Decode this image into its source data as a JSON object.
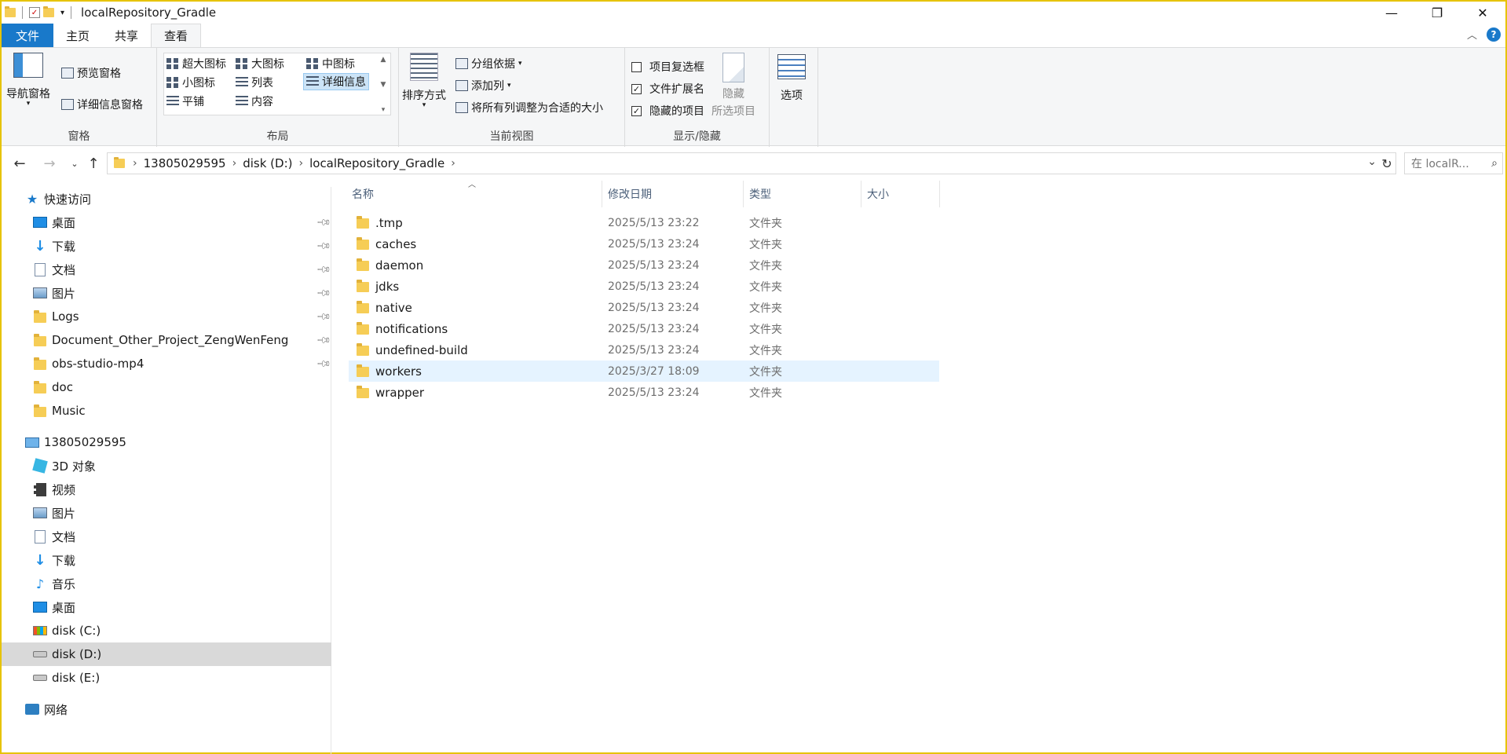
{
  "window": {
    "title": "localRepository_Gradle",
    "controls": {
      "minimize": "—",
      "maximize": "❐",
      "close": "✕"
    }
  },
  "tabs": [
    {
      "label": "文件"
    },
    {
      "label": "主页"
    },
    {
      "label": "共享"
    },
    {
      "label": "查看"
    }
  ],
  "ribbon": {
    "panes": {
      "nav_pane": "导航窗格",
      "preview_pane": "预览窗格",
      "details_pane": "详细信息窗格",
      "group_label": "窗格"
    },
    "layout": {
      "extra_large": "超大图标",
      "large": "大图标",
      "medium": "中图标",
      "small": "小图标",
      "list": "列表",
      "details": "详细信息",
      "tiles": "平铺",
      "content": "内容",
      "group_label": "布局"
    },
    "current_view": {
      "sort_by": "排序方式",
      "group_by": "分组依据",
      "add_columns": "添加列",
      "fit_columns": "将所有列调整为合适的大小",
      "group_label": "当前视图"
    },
    "show_hide": {
      "item_checkboxes": "项目复选框",
      "item_checkboxes_checked": false,
      "file_extensions": "文件扩展名",
      "file_extensions_checked": true,
      "hidden_items": "隐藏的项目",
      "hidden_items_checked": true,
      "hide_selected_line1": "隐藏",
      "hide_selected_line2": "所选项目",
      "group_label": "显示/隐藏"
    },
    "options": "选项"
  },
  "address": {
    "crumbs": [
      "13805029595",
      "disk (D:)",
      "localRepository_Gradle"
    ],
    "search_placeholder": "在 localR..."
  },
  "sidebar": {
    "quick_access": "快速访问",
    "pinned": [
      {
        "label": "桌面",
        "icon": "desktop-icon"
      },
      {
        "label": "下载",
        "icon": "download-icon"
      },
      {
        "label": "文档",
        "icon": "document-icon"
      },
      {
        "label": "图片",
        "icon": "pictures-icon"
      },
      {
        "label": "Logs",
        "icon": "folder-icon"
      },
      {
        "label": "Document_Other_Project_ZengWenFeng",
        "icon": "folder-icon"
      },
      {
        "label": "obs-studio-mp4",
        "icon": "folder-icon"
      },
      {
        "label": "doc",
        "icon": "folder-icon"
      },
      {
        "label": "Music",
        "icon": "folder-icon"
      }
    ],
    "this_pc": "13805029595",
    "pc_items": [
      {
        "label": "3D 对象",
        "icon": "3d-objects-icon"
      },
      {
        "label": "视频",
        "icon": "videos-icon"
      },
      {
        "label": "图片",
        "icon": "pictures-icon"
      },
      {
        "label": "文档",
        "icon": "document-icon"
      },
      {
        "label": "下载",
        "icon": "download-icon"
      },
      {
        "label": "音乐",
        "icon": "music-icon"
      },
      {
        "label": "桌面",
        "icon": "desktop-icon"
      },
      {
        "label": "disk (C:)",
        "icon": "drive-c-icon"
      },
      {
        "label": "disk (D:)",
        "icon": "drive-icon"
      },
      {
        "label": "disk (E:)",
        "icon": "drive-icon"
      }
    ],
    "network": "网络"
  },
  "columns": {
    "name": "名称",
    "modified": "修改日期",
    "type": "类型",
    "size": "大小"
  },
  "files": [
    {
      "name": ".tmp",
      "modified": "2025/5/13 23:22",
      "type": "文件夹"
    },
    {
      "name": "caches",
      "modified": "2025/5/13 23:24",
      "type": "文件夹"
    },
    {
      "name": "daemon",
      "modified": "2025/5/13 23:24",
      "type": "文件夹"
    },
    {
      "name": "jdks",
      "modified": "2025/5/13 23:24",
      "type": "文件夹"
    },
    {
      "name": "native",
      "modified": "2025/5/13 23:24",
      "type": "文件夹"
    },
    {
      "name": "notifications",
      "modified": "2025/5/13 23:24",
      "type": "文件夹"
    },
    {
      "name": "undefined-build",
      "modified": "2025/5/13 23:24",
      "type": "文件夹"
    },
    {
      "name": "workers",
      "modified": "2025/3/27 18:09",
      "type": "文件夹"
    },
    {
      "name": "wrapper",
      "modified": "2025/5/13 23:24",
      "type": "文件夹"
    }
  ],
  "colors": {
    "accent": "#1979ca",
    "window_border": "#e6c300",
    "hover_row": "#e5f3ff",
    "selected_nav": "#d9d9d9"
  }
}
